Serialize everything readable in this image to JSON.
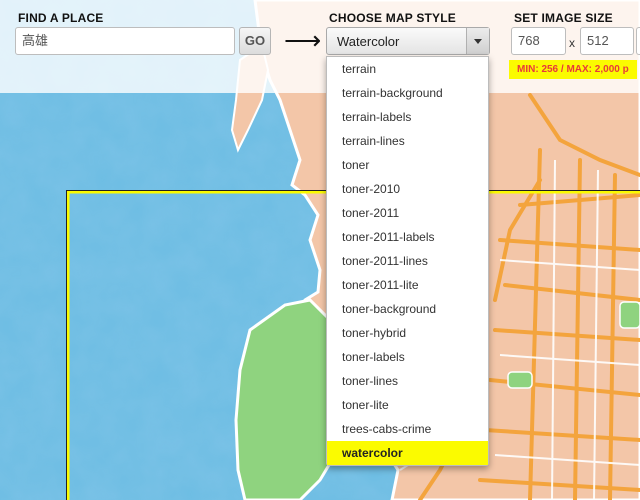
{
  "find_place": {
    "label": "FIND A PLACE",
    "query": "高雄",
    "go_label": "GO"
  },
  "arrow_glyph": "⟶",
  "map_style": {
    "label": "CHOOSE MAP STYLE",
    "selected": "Watercolor",
    "options": [
      "terrain",
      "terrain-background",
      "terrain-labels",
      "terrain-lines",
      "toner",
      "toner-2010",
      "toner-2011",
      "toner-2011-labels",
      "toner-2011-lines",
      "toner-2011-lite",
      "toner-background",
      "toner-hybrid",
      "toner-labels",
      "toner-lines",
      "toner-lite",
      "trees-cabs-crime",
      "watercolor"
    ]
  },
  "image_size": {
    "label": "SET IMAGE SIZE",
    "width": "768",
    "height": "512",
    "separator": "x",
    "note": "MIN: 256 / MAX: 2,000 p"
  },
  "colors": {
    "highlight": "#fbfb00",
    "note_text": "#e83a3a",
    "water": "#69b8e0",
    "land": "#f3c6a8",
    "park": "#8fd37f",
    "road": "#f4a640"
  }
}
